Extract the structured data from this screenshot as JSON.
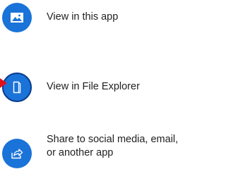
{
  "options": [
    {
      "label": "View in this app",
      "icon": "image-icon"
    },
    {
      "label": "View in File Explorer",
      "icon": "folder-icon"
    },
    {
      "label_line1": "Share to social media, email,",
      "label_line2": "or another app",
      "icon": "share-icon"
    }
  ],
  "colors": {
    "accent": "#1a73d8",
    "focus_ring": "#0b3c8c",
    "pointer": "#e0111b",
    "text": "#1f1f1f"
  }
}
